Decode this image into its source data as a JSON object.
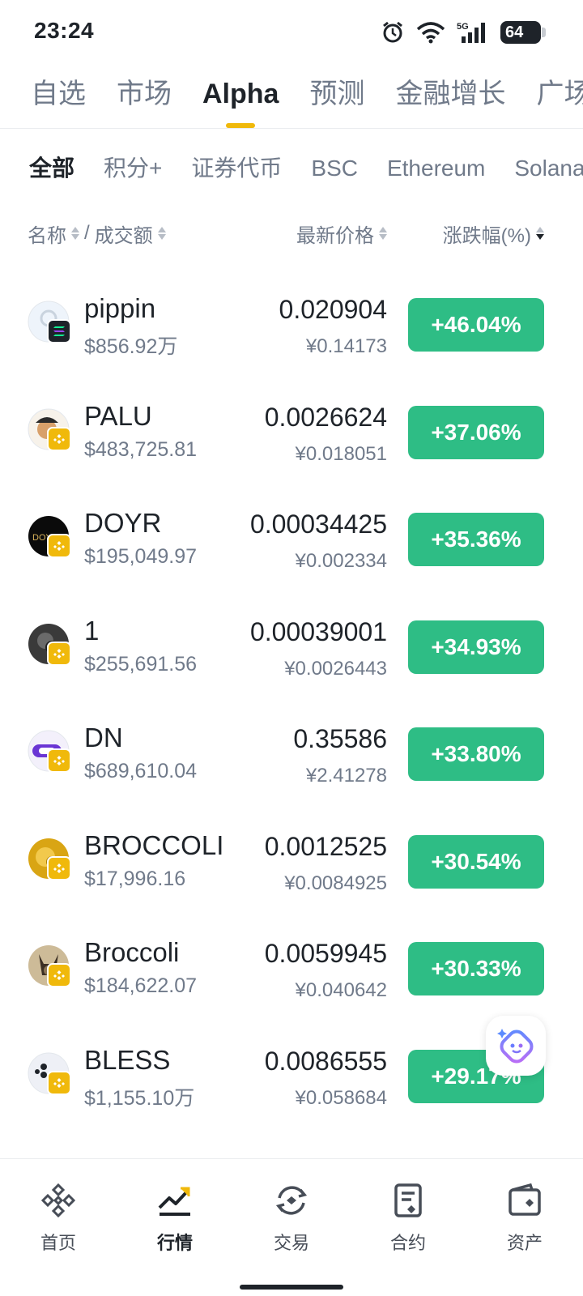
{
  "status_bar": {
    "time": "23:24",
    "battery": "64",
    "icons": [
      "alarm-icon",
      "wifi-icon",
      "5g-signal-icon",
      "battery-icon"
    ]
  },
  "main_tabs": [
    {
      "label": "自选"
    },
    {
      "label": "市场"
    },
    {
      "label": "Alpha",
      "active": true
    },
    {
      "label": "预测"
    },
    {
      "label": "金融增长"
    },
    {
      "label": "广场"
    }
  ],
  "sub_tabs": [
    {
      "label": "全部",
      "active": true
    },
    {
      "label": "积分+"
    },
    {
      "label": "证券代币"
    },
    {
      "label": "BSC"
    },
    {
      "label": "Ethereum"
    },
    {
      "label": "Solana"
    }
  ],
  "columns": {
    "name": "名称",
    "volume": "成交额",
    "price": "最新价格",
    "change": "涨跌幅(%)"
  },
  "tokens": [
    {
      "symbol": "pippin",
      "volume": "$856.92万",
      "price": "0.020904",
      "cny": "¥0.14173",
      "change": "+46.04%",
      "chain": "solana"
    },
    {
      "symbol": "PALU",
      "volume": "$483,725.81",
      "price": "0.0026624",
      "cny": "¥0.018051",
      "change": "+37.06%",
      "chain": "bsc"
    },
    {
      "symbol": "DOYR",
      "volume": "$195,049.97",
      "price": "0.00034425",
      "cny": "¥0.002334",
      "change": "+35.36%",
      "chain": "bsc"
    },
    {
      "symbol": "1",
      "volume": "$255,691.56",
      "price": "0.00039001",
      "cny": "¥0.0026443",
      "change": "+34.93%",
      "chain": "bsc"
    },
    {
      "symbol": "DN",
      "volume": "$689,610.04",
      "price": "0.35586",
      "cny": "¥2.41278",
      "change": "+33.80%",
      "chain": "bsc"
    },
    {
      "symbol": "BROCCOLI",
      "volume": "$17,996.16",
      "price": "0.0012525",
      "cny": "¥0.0084925",
      "change": "+30.54%",
      "chain": "bsc"
    },
    {
      "symbol": "Broccoli",
      "volume": "$184,622.07",
      "price": "0.0059945",
      "cny": "¥0.040642",
      "change": "+30.33%",
      "chain": "bsc"
    },
    {
      "symbol": "BLESS",
      "volume": "$1,155.10万",
      "price": "0.0086555",
      "cny": "¥0.058684",
      "change": "+29.17%",
      "chain": "bsc"
    }
  ],
  "bottom_nav": [
    {
      "label": "首页",
      "icon": "home-diamond-icon"
    },
    {
      "label": "行情",
      "icon": "market-chart-icon",
      "active": true
    },
    {
      "label": "交易",
      "icon": "trade-swap-icon"
    },
    {
      "label": "合约",
      "icon": "futures-doc-icon"
    },
    {
      "label": "资产",
      "icon": "wallet-icon"
    }
  ],
  "colors": {
    "accent": "#f0b90b",
    "up": "#2ebd85",
    "text": "#1e2329",
    "muted": "#707a8a"
  }
}
